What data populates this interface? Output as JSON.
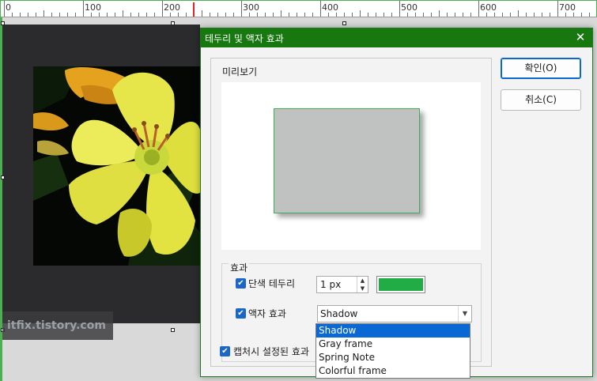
{
  "ruler": {
    "labels": [
      "0",
      "100",
      "200",
      "300",
      "400",
      "500",
      "600",
      "700"
    ]
  },
  "watermark": "itfix.tistory.com",
  "dialog": {
    "title": "테두리 및 액자 효과",
    "close_icon": "close-icon",
    "preview_label": "미리보기",
    "effect_group_label": "효과",
    "border_checkbox_label": "단색 테두리",
    "border_checked": true,
    "border_width": "1 px",
    "border_color": "#22ac46",
    "frame_checkbox_label": "액자 효과",
    "frame_checked": true,
    "frame_select_value": "Shadow",
    "frame_options": [
      "Shadow",
      "Gray frame",
      "Spring Note",
      "Colorful frame"
    ],
    "frame_selected_index": 0,
    "capture_checkbox_label": "캡처시 설정된 효과",
    "capture_checked": true,
    "ok_label": "확인(O)",
    "cancel_label": "취소(C)"
  }
}
